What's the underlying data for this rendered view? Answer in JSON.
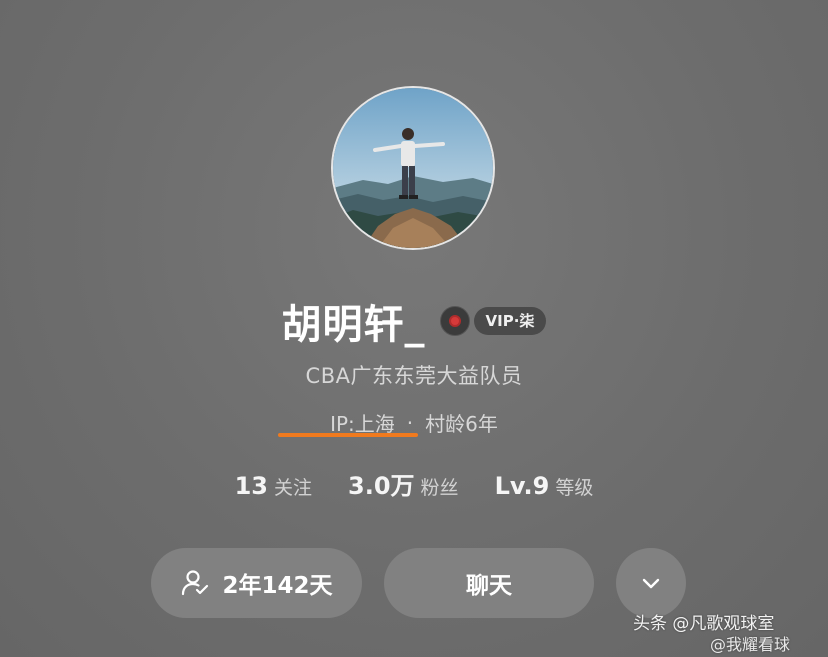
{
  "profile": {
    "name": "胡明轩_",
    "vip_badge": "VIP·柒",
    "bio": "CBA广东东莞大益队员",
    "ip_location": "IP:上海",
    "separator": "·",
    "account_age": "村龄6年"
  },
  "stats": [
    {
      "value": "13",
      "label": "关注"
    },
    {
      "value": "3.0万",
      "label": "粉丝"
    },
    {
      "value": "Lv.9",
      "label": "等级"
    }
  ],
  "actions": {
    "friend_days": "2年142天",
    "chat": "聊天"
  },
  "watermark": {
    "line1": "头条 @凡歌观球室",
    "line2": "@我耀看球"
  },
  "colors": {
    "background": "#6f6f6f",
    "ip_underline": "#f07a1e",
    "button": "#818181"
  },
  "icons": {
    "vinyl": "vinyl-record-icon",
    "friend": "user-check-icon",
    "more": "chevron-down-icon"
  }
}
